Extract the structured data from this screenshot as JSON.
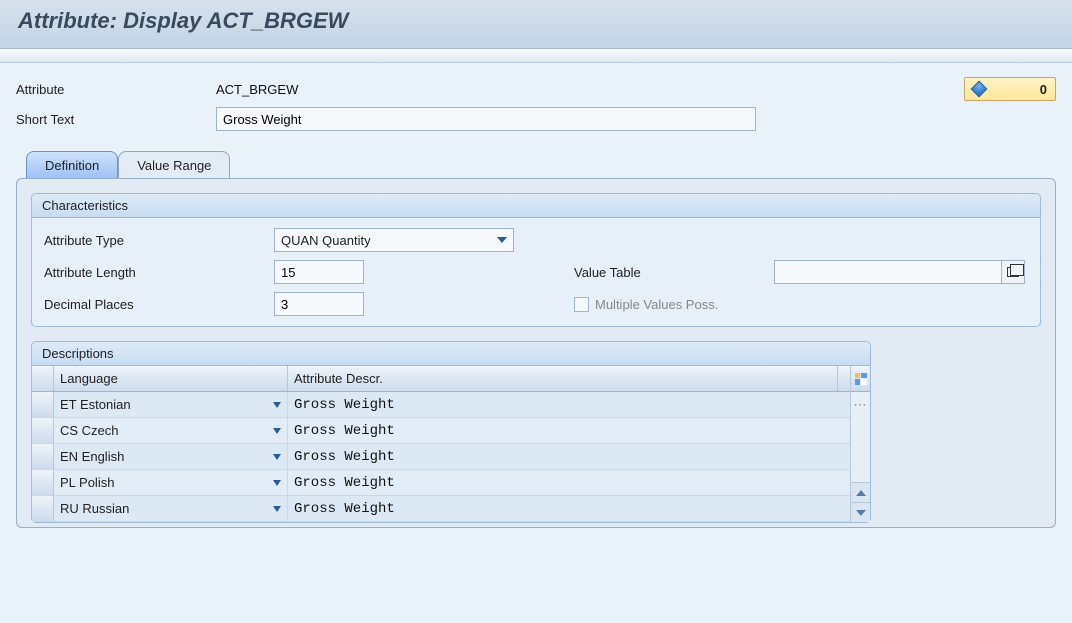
{
  "title": "Attribute: Display ACT_BRGEW",
  "header": {
    "attribute_label": "Attribute",
    "attribute_value": "ACT_BRGEW",
    "short_text_label": "Short Text",
    "short_text_value": "Gross Weight",
    "badge_value": "0"
  },
  "tabs": {
    "definition": "Definition",
    "value_range": "Value Range"
  },
  "characteristics": {
    "group_title": "Characteristics",
    "attr_type_label": "Attribute Type",
    "attr_type_value": "QUAN Quantity",
    "attr_length_label": "Attribute Length",
    "attr_length_value": "15",
    "decimal_places_label": "Decimal Places",
    "decimal_places_value": "3",
    "value_table_label": "Value Table",
    "value_table_value": "",
    "multiple_values_label": "Multiple Values Poss."
  },
  "descriptions": {
    "group_title": "Descriptions",
    "col_language": "Language",
    "col_attr_descr": "Attribute Descr.",
    "rows": [
      {
        "lang": "ET Estonian",
        "descr": "Gross Weight"
      },
      {
        "lang": "CS Czech",
        "descr": "Gross Weight"
      },
      {
        "lang": "EN English",
        "descr": "Gross Weight"
      },
      {
        "lang": "PL Polish",
        "descr": "Gross Weight"
      },
      {
        "lang": "RU Russian",
        "descr": "Gross Weight"
      }
    ]
  }
}
